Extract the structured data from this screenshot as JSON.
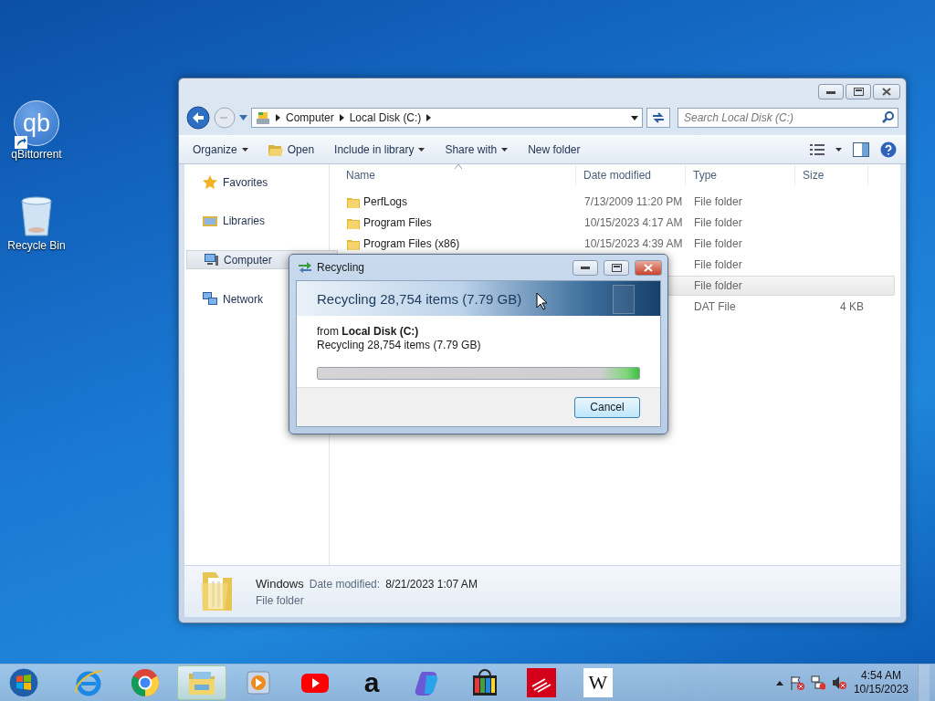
{
  "desktop_icons": [
    {
      "kind": "qbittorrent",
      "glyph": "qb",
      "label": "qBittorrent"
    },
    {
      "kind": "recycle_bin",
      "label": "Recycle Bin"
    }
  ],
  "explorer": {
    "breadcrumb": [
      "Computer",
      "Local Disk (C:)"
    ],
    "search": {
      "placeholder": "Search Local Disk (C:)"
    },
    "toolbar": [
      {
        "kind": "menu",
        "label": "Organize",
        "dropdown": true
      },
      {
        "kind": "open",
        "label": "Open",
        "dropdown": false
      },
      {
        "kind": "menu",
        "label": "Include in library",
        "dropdown": true
      },
      {
        "kind": "menu",
        "label": "Share with",
        "dropdown": true
      },
      {
        "kind": "menu",
        "label": "New folder",
        "dropdown": false
      }
    ],
    "nav": [
      {
        "kind": "favorites",
        "label": "Favorites",
        "selected": false
      },
      {
        "kind": "libraries",
        "label": "Libraries",
        "selected": false
      },
      {
        "kind": "computer",
        "label": "Computer",
        "selected": true
      },
      {
        "kind": "network",
        "label": "Network",
        "selected": false
      }
    ],
    "columns": [
      "Name",
      "Date modified",
      "Type",
      "Size"
    ],
    "rows": [
      {
        "kind": "folder",
        "name": "PerfLogs",
        "date": "7/13/2009 11:20 PM",
        "type": "File folder",
        "selected": false
      },
      {
        "kind": "folder",
        "name": "Program Files",
        "date": "10/15/2023 4:17 AM",
        "type": "File folder",
        "selected": false
      },
      {
        "kind": "folder",
        "name": "Program Files (x86)",
        "date": "10/15/2023 4:39 AM",
        "type": "File folder",
        "selected": false
      },
      {
        "type": "File folder",
        "selected": false
      },
      {
        "type": "File folder",
        "selected": true
      },
      {
        "type": "DAT File",
        "size": "4 KB",
        "selected": false
      }
    ],
    "details": {
      "name": "Windows",
      "date_label": "Date modified:",
      "date": "8/21/2023 1:07 AM",
      "type": "File folder"
    }
  },
  "dialog": {
    "title": "Recycling",
    "heading": "Recycling 28,754 items (7.79 GB)",
    "from": "from **Local Disk (C:)**",
    "status": "Recycling 28,754 items (7.79 GB)",
    "progress": {
      "level": 1.0
    },
    "button": "Cancel"
  },
  "taskbar": {
    "apps": [
      {
        "kind": "ie",
        "selected": false
      },
      {
        "kind": "chrome",
        "selected": false
      },
      {
        "kind": "explorer",
        "selected": true
      },
      {
        "kind": "media",
        "selected": false
      },
      {
        "kind": "youtube",
        "selected": false
      },
      {
        "kind": "amazon",
        "glyph": "a",
        "selected": false
      },
      {
        "kind": "copilot",
        "selected": false
      },
      {
        "kind": "store",
        "selected": false
      },
      {
        "kind": "bank",
        "selected": false
      },
      {
        "kind": "wikipedia",
        "glyph": "W",
        "selected": false
      }
    ],
    "time": "4:54 AM",
    "date": "10/15/2023"
  }
}
